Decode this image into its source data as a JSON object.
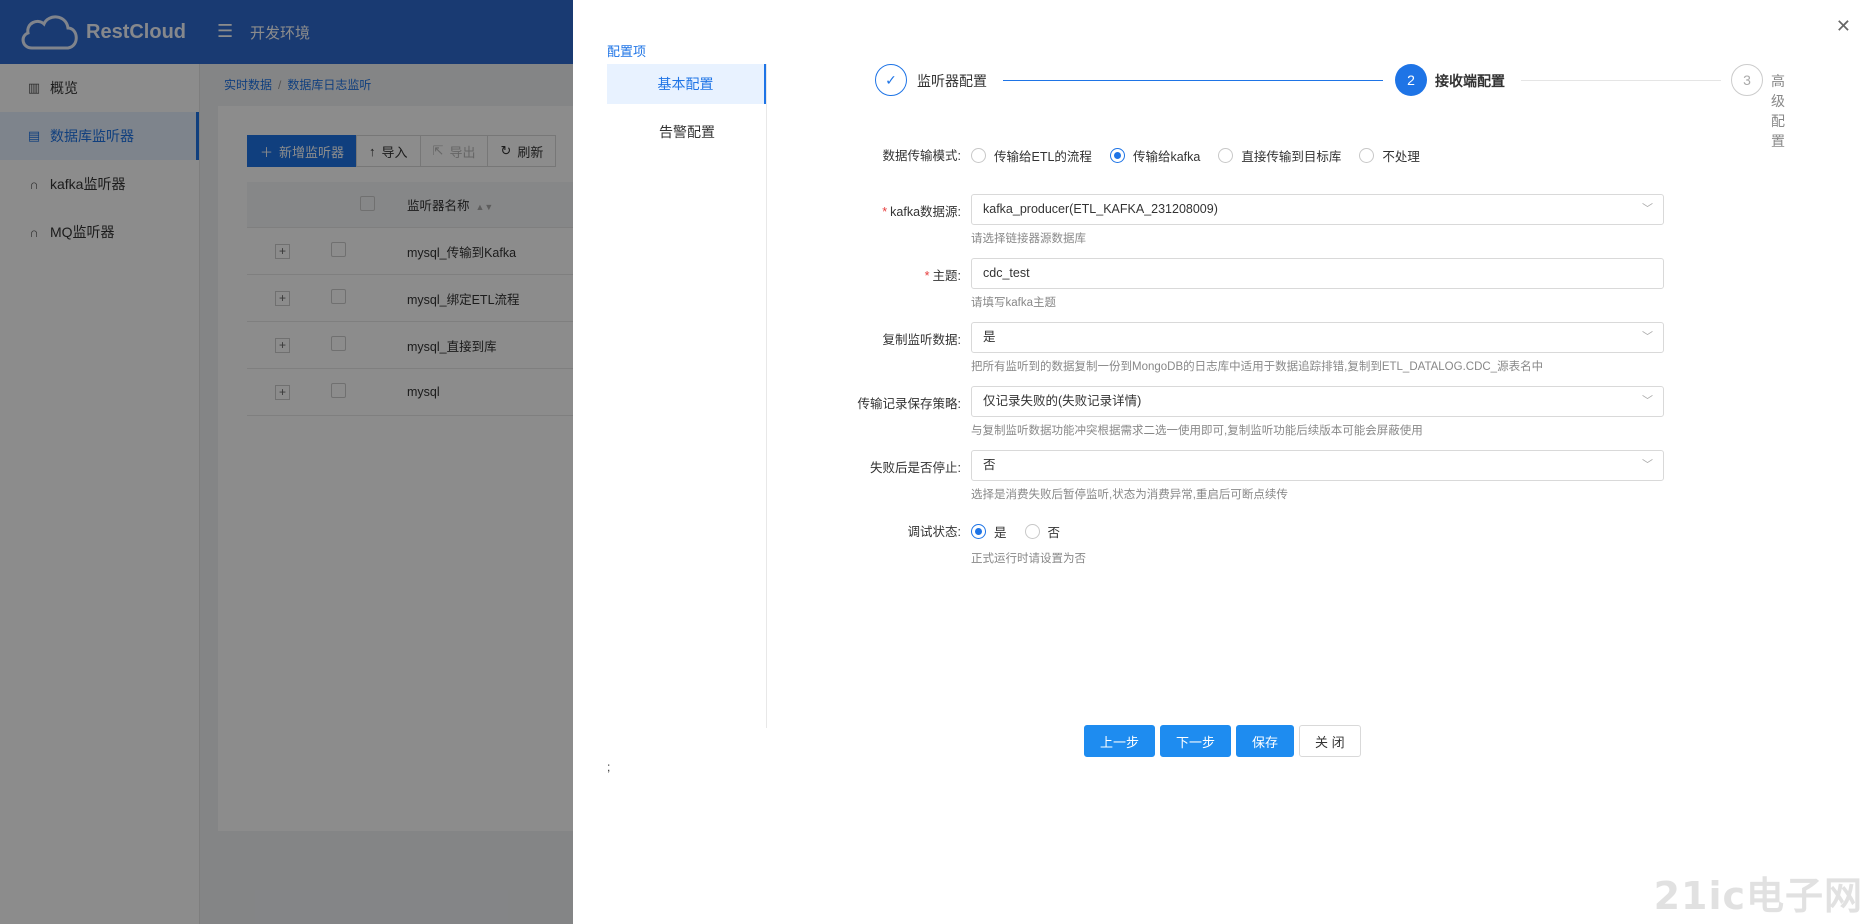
{
  "app": {
    "logo_text": "RestCloud",
    "env": "开发环境"
  },
  "sidebar": {
    "items": [
      {
        "label": "概览",
        "icon": "bar-chart-icon"
      },
      {
        "label": "数据库监听器",
        "icon": "database-icon",
        "active": true
      },
      {
        "label": "kafka监听器",
        "icon": "headset-icon"
      },
      {
        "label": "MQ监听器",
        "icon": "headset-icon"
      }
    ]
  },
  "breadcrumb": {
    "items": [
      "实时数据",
      "数据库日志监听"
    ]
  },
  "toolbar": {
    "add": "新增监听器",
    "import": "导入",
    "export": "导出",
    "refresh": "刷新"
  },
  "table": {
    "header_name": "监听器名称",
    "rows": [
      "mysql_传输到Kafka",
      "mysql_绑定ETL流程",
      "mysql_直接到库",
      "mysql"
    ]
  },
  "drawer": {
    "nav_title": "配置项",
    "nav_items": [
      "基本配置",
      "告警配置"
    ],
    "steps": [
      {
        "number": "1",
        "label": "监听器配置",
        "status": "done"
      },
      {
        "number": "2",
        "label": "接收端配置",
        "status": "current"
      },
      {
        "number": "3",
        "label": "高级配置",
        "status": "wait"
      }
    ],
    "form": {
      "mode": {
        "label": "数据传输模式:",
        "options": [
          "传输给ETL的流程",
          "传输给kafka",
          "直接传输到目标库",
          "不处理"
        ],
        "selected": "传输给kafka"
      },
      "kafka_source": {
        "label": "kafka数据源:",
        "value": "kafka_producer(ETL_KAFKA_231208009)",
        "help": "请选择链接器源数据库"
      },
      "topic": {
        "label": "主题:",
        "value": "cdc_test",
        "help": "请填写kafka主题"
      },
      "copy_data": {
        "label": "复制监听数据:",
        "value": "是",
        "help": "把所有监听到的数据复制一份到MongoDB的日志库中适用于数据追踪排错,复制到ETL_DATALOG.CDC_源表名中"
      },
      "record_policy": {
        "label": "传输记录保存策略:",
        "value": "仅记录失败的(失败记录详情)",
        "help": "与复制监听数据功能冲突根据需求二选一使用即可,复制监听功能后续版本可能会屏蔽使用"
      },
      "stop_on_fail": {
        "label": "失败后是否停止:",
        "value": "否",
        "help": "选择是消费失败后暂停监听,状态为消费异常,重启后可断点续传"
      },
      "debug": {
        "label": "调试状态:",
        "options": [
          "是",
          "否"
        ],
        "selected": "是",
        "help": "正式运行时请设置为否"
      }
    },
    "buttons": {
      "prev": "上一步",
      "next": "下一步",
      "save": "保存",
      "close": "关 闭"
    },
    "stray_text": ";"
  },
  "watermark": "21ic电子网",
  "colors": {
    "primary": "#1e74e6",
    "topbar": "#2f6ad0",
    "required": "#e63c3c"
  }
}
